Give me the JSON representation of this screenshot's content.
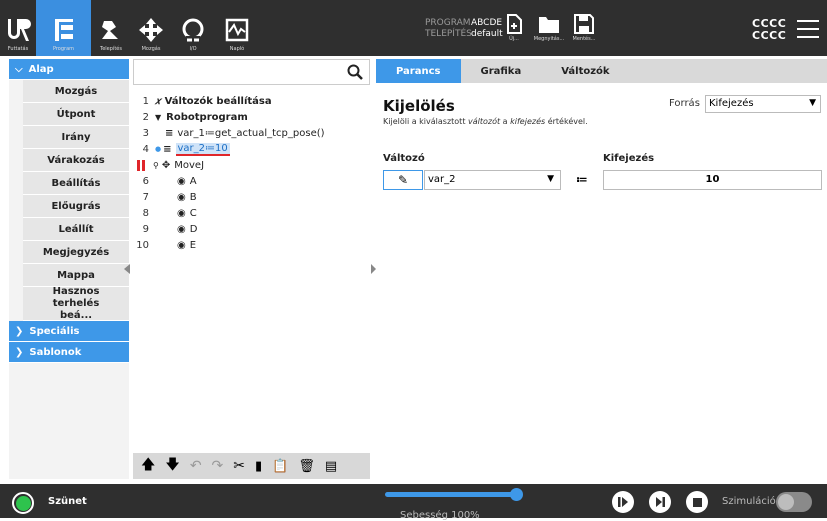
{
  "topnav": [
    {
      "label": "Futtatás",
      "icon": "ur-logo-icon"
    },
    {
      "label": "Program",
      "icon": "program-icon"
    },
    {
      "label": "Telepítés",
      "icon": "installation-icon"
    },
    {
      "label": "Mozgás",
      "icon": "move-icon"
    },
    {
      "label": "I/O",
      "icon": "io-icon"
    },
    {
      "label": "Napló",
      "icon": "log-icon"
    }
  ],
  "program": {
    "program_key": "PROGRAM",
    "program_val": "ABCDE",
    "install_key": "TELEPÍTÉS",
    "install_val": "default"
  },
  "file": {
    "new": "Új...",
    "open": "Megnyitás...",
    "save": "Mentés..."
  },
  "cccc1": "CCCC",
  "cccc2": "CCCC",
  "left": {
    "cat_basic": "Alap",
    "items": [
      "Mozgás",
      "Útpont",
      "Irány",
      "Várakozás",
      "Beállítás",
      "Előugrás",
      "Leállít",
      "Megjegyzés",
      "Mappa",
      "Hasznos terhelés beá..."
    ],
    "cat_special": "Speciális",
    "cat_templates": "Sablonok"
  },
  "tree": {
    "lines": [
      {
        "n": "1",
        "text": "Változók beállítása"
      },
      {
        "n": "2",
        "text": "Robotprogram"
      },
      {
        "n": "3",
        "text": "var_1≔get_actual_tcp_pose()"
      },
      {
        "n": "4",
        "text": "var_2≔10"
      },
      {
        "n": "",
        "text": "MoveJ"
      },
      {
        "n": "6",
        "text": "A"
      },
      {
        "n": "7",
        "text": "B"
      },
      {
        "n": "8",
        "text": "C"
      },
      {
        "n": "9",
        "text": "D"
      },
      {
        "n": "10",
        "text": "E"
      }
    ]
  },
  "tabs": [
    "Parancs",
    "Grafika",
    "Változók"
  ],
  "cmd": {
    "title": "Kijelölés",
    "desc_pre": "Kijelöli a kiválasztott ",
    "desc_var": "változót",
    "desc_mid": " a ",
    "desc_expr": "kifejezés",
    "desc_post": " értékével.",
    "source_label": "Forrás",
    "source_value": "Kifejezés",
    "var_label": "Változó",
    "var_value": "var_2",
    "assign": "≔",
    "expr_label": "Kifejezés",
    "expr_value": "10"
  },
  "bottom": {
    "status": "Szünet",
    "speed": "Sebesség 100%",
    "sim": "Szimuláció"
  },
  "colors": {
    "accent": "#3e98e8",
    "bar": "#2f2f2f",
    "stop": "#e0262a",
    "green": "#2ec34d"
  }
}
